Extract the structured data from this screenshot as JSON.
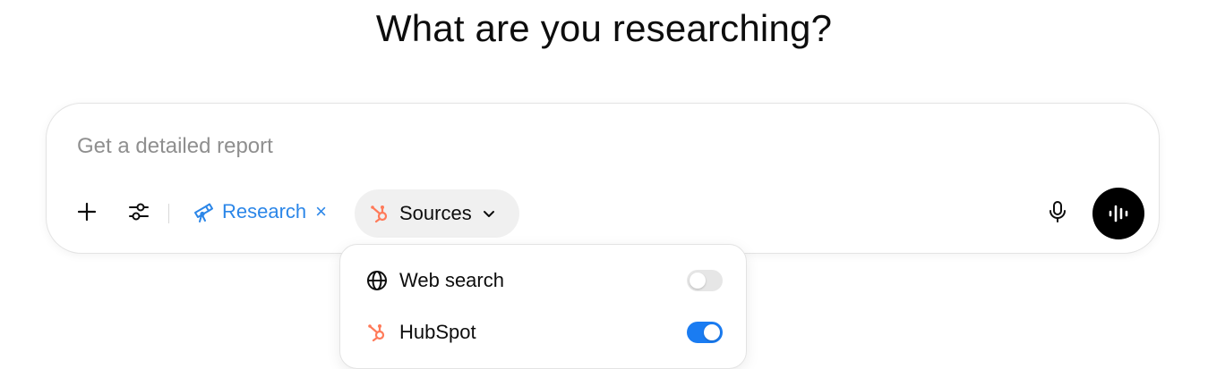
{
  "heading": "What are you researching?",
  "composer": {
    "placeholder": "Get a detailed report",
    "value": ""
  },
  "toolbar": {
    "add_icon": "plus-icon",
    "tools_icon": "sliders-icon",
    "research_chip": {
      "icon": "telescope-icon",
      "label": "Research",
      "close_symbol": "×"
    },
    "sources_button": {
      "icon": "hubspot-icon",
      "label": "Sources",
      "chevron_icon": "chevron-down-icon"
    },
    "mic_icon": "microphone-icon",
    "voice_icon": "voice-waveform-icon"
  },
  "sources_menu": {
    "items": [
      {
        "label": "Web search",
        "icon": "globe-icon",
        "enabled": false
      },
      {
        "label": "HubSpot",
        "icon": "hubspot-icon",
        "enabled": true
      }
    ]
  },
  "colors": {
    "accent_blue": "#2b86e8",
    "toggle_on": "#1a7cf2",
    "toggle_off": "#e6e6e6",
    "hubspot_orange": "#ff7a59",
    "voice_button_bg": "#000000",
    "chip_bg": "#f0f0f0"
  }
}
